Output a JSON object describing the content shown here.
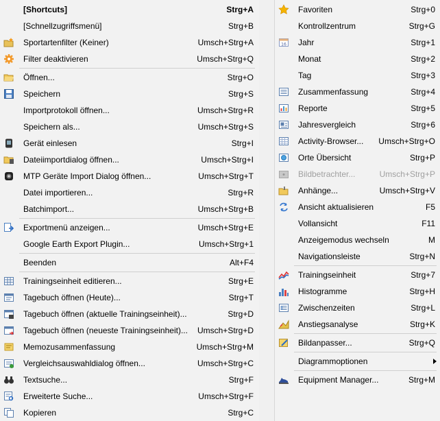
{
  "left_menu": {
    "items": [
      {
        "label": "[Shortcuts]",
        "shortcut": "Strg+A",
        "icon": "none",
        "bold": true
      },
      {
        "label": "[Schnellzugriffsmenü]",
        "shortcut": "Strg+B",
        "icon": "none"
      },
      {
        "label": "Sportartenfilter (Keiner)",
        "shortcut": "Umsch+Strg+A",
        "icon": "folder-star-icon"
      },
      {
        "label": "Filter deaktivieren",
        "shortcut": "Umsch+Strg+Q",
        "icon": "gear-orange-icon"
      },
      {
        "label": "Öffnen...",
        "shortcut": "Strg+O",
        "icon": "folder-open-icon"
      },
      {
        "label": "Speichern",
        "shortcut": "Strg+S",
        "icon": "floppy-icon"
      },
      {
        "label": "Importprotokoll öffnen...",
        "shortcut": "Umsch+Strg+R",
        "icon": "none"
      },
      {
        "label": "Speichern als...",
        "shortcut": "Umsch+Strg+S",
        "icon": "none"
      },
      {
        "label": "Gerät einlesen",
        "shortcut": "Strg+I",
        "icon": "device-icon"
      },
      {
        "label": "Dateiimportdialog öffnen...",
        "shortcut": "Umsch+Strg+I",
        "icon": "folder-import-icon"
      },
      {
        "label": "MTP Geräte Import Dialog öffnen...",
        "shortcut": "Umsch+Strg+T",
        "icon": "camera-icon"
      },
      {
        "label": "Datei importieren...",
        "shortcut": "Strg+R",
        "icon": "none"
      },
      {
        "label": "Batchimport...",
        "shortcut": "Umsch+Strg+B",
        "icon": "none"
      },
      {
        "label": "Exportmenü anzeigen...",
        "shortcut": "Umsch+Strg+E",
        "icon": "export-icon"
      },
      {
        "label": "Google Earth Export Plugin...",
        "shortcut": "Umsch+Strg+1",
        "icon": "none"
      },
      {
        "label": "Beenden",
        "shortcut": "Alt+F4",
        "icon": "none"
      },
      {
        "label": "Trainingseinheit editieren...",
        "shortcut": "Strg+E",
        "icon": "table-icon"
      },
      {
        "label": "Tagebuch öffnen (Heute)...",
        "shortcut": "Strg+T",
        "icon": "calendar-icon"
      },
      {
        "label": "Tagebuch öffnen (aktuelle Trainingseinheit)...",
        "shortcut": "Strg+D",
        "icon": "calendar-current-icon"
      },
      {
        "label": "Tagebuch öffnen (neueste Trainingseinheit)...",
        "shortcut": "Umsch+Strg+D",
        "icon": "calendar-latest-icon"
      },
      {
        "label": "Memozusammenfassung",
        "shortcut": "Umsch+Strg+M",
        "icon": "memo-icon"
      },
      {
        "label": "Vergleichsauswahldialog öffnen...",
        "shortcut": "Umsch+Strg+C",
        "icon": "compare-icon"
      },
      {
        "label": "Textsuche...",
        "shortcut": "Strg+F",
        "icon": "binoculars-icon"
      },
      {
        "label": "Erweiterte Suche...",
        "shortcut": "Umsch+Strg+F",
        "icon": "search-list-icon"
      },
      {
        "label": "Kopieren",
        "shortcut": "Strg+C",
        "icon": "copy-icon"
      }
    ]
  },
  "right_menu": {
    "items": [
      {
        "label": "Favoriten",
        "shortcut": "Strg+0",
        "icon": "star-icon"
      },
      {
        "label": "Kontrollzentrum",
        "shortcut": "Strg+G",
        "icon": "none"
      },
      {
        "label": "Jahr",
        "shortcut": "Strg+1",
        "icon": "calendar-year-icon"
      },
      {
        "label": "Monat",
        "shortcut": "Strg+2",
        "icon": "none"
      },
      {
        "label": "Tag",
        "shortcut": "Strg+3",
        "icon": "none"
      },
      {
        "label": "Zusammenfassung",
        "shortcut": "Strg+4",
        "icon": "summary-icon"
      },
      {
        "label": "Reporte",
        "shortcut": "Strg+5",
        "icon": "report-chart-icon"
      },
      {
        "label": "Jahresvergleich",
        "shortcut": "Strg+6",
        "icon": "year-compare-icon"
      },
      {
        "label": "Activity-Browser...",
        "shortcut": "Umsch+Strg+O",
        "icon": "grid-icon"
      },
      {
        "label": "Orte Übersicht",
        "shortcut": "Strg+P",
        "icon": "globe-icon"
      },
      {
        "label": "Bildbetrachter...",
        "shortcut": "Umsch+Strg+P",
        "icon": "image-viewer-icon",
        "disabled": true
      },
      {
        "label": "Anhänge...",
        "shortcut": "Umsch+Strg+V",
        "icon": "attachment-folder-icon"
      },
      {
        "label": "Ansicht aktualisieren",
        "shortcut": "F5",
        "icon": "refresh-icon"
      },
      {
        "label": "Vollansicht",
        "shortcut": "F11",
        "icon": "none"
      },
      {
        "label": "Anzeigemodus wechseln",
        "shortcut": "M",
        "icon": "none"
      },
      {
        "label": "Navigationsleiste",
        "shortcut": "Strg+N",
        "icon": "none"
      },
      {
        "label": "Trainingseinheit",
        "shortcut": "Strg+7",
        "icon": "line-chart-icon"
      },
      {
        "label": "Histogramme",
        "shortcut": "Strg+H",
        "icon": "histogram-icon"
      },
      {
        "label": "Zwischenzeiten",
        "shortcut": "Strg+L",
        "icon": "split-times-icon"
      },
      {
        "label": "Anstiegsanalyse",
        "shortcut": "Strg+K",
        "icon": "climb-icon"
      },
      {
        "label": "Bildanpasser...",
        "shortcut": "Strg+Q",
        "icon": "image-adjust-icon"
      },
      {
        "label": "Diagrammoptionen",
        "shortcut": "",
        "icon": "none"
      },
      {
        "label": "Equipment Manager...",
        "shortcut": "Strg+M",
        "icon": "shoe-icon"
      }
    ]
  }
}
